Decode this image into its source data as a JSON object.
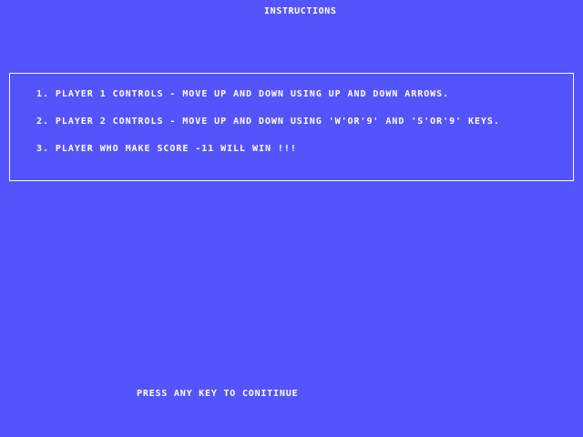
{
  "screen": {
    "title": "INSTRUCTIONS",
    "instructions": [
      "1. PLAYER 1 CONTROLS - MOVE UP AND DOWN USING UP AND DOWN ARROWS.",
      "2. PLAYER 2 CONTROLS - MOVE UP AND DOWN USING 'W'OR'9' AND 'S'OR'9' KEYS.",
      "3. PLAYER WHO MAKE SCORE -11 WILL WIN !!!"
    ],
    "prompt": "PRESS ANY KEY TO CONITINUE"
  },
  "colors": {
    "background": "#5454fc",
    "text": "#ffffff",
    "border": "#fcfcfc"
  }
}
